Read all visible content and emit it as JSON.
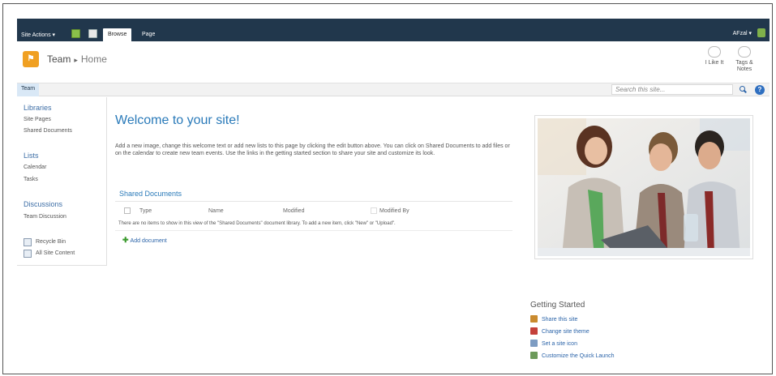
{
  "ribbon": {
    "site_actions": "Site Actions ▾",
    "tabs": [
      {
        "label": "Browse"
      },
      {
        "label": "Page"
      }
    ],
    "user": "AFzal ▾"
  },
  "header": {
    "site_name": "Team",
    "separator": "▸",
    "page_name": "Home",
    "i_like_it": "I Like It",
    "tags_notes_1": "Tags &",
    "tags_notes_2": "Notes"
  },
  "topnav": {
    "team": "Team",
    "search_placeholder": "Search this site..."
  },
  "leftnav": {
    "libraries": "Libraries",
    "site_pages": "Site Pages",
    "shared_documents": "Shared Documents",
    "lists": "Lists",
    "calendar": "Calendar",
    "tasks": "Tasks",
    "discussions": "Discussions",
    "team_discussion": "Team Discussion",
    "recycle_bin": "Recycle Bin",
    "all_site_content": "All Site Content"
  },
  "main": {
    "title": "Welcome to your site!",
    "intro": "Add a new image, change this welcome text or add new lists to this page by clicking the edit button above. You can click on Shared Documents to add files or on the calendar to create new team events. Use the links in the getting started section to share your site and customize its look.",
    "shared_title": "Shared Documents",
    "columns": [
      "Type",
      "Name",
      "Modified",
      "Modified By"
    ],
    "empty_message": "There are no items to show in this view of the \"Shared Documents\" document library. To add a new item, click \"New\" or \"Upload\".",
    "add_document": "Add document"
  },
  "getting_started": {
    "title": "Getting Started",
    "items": [
      {
        "label": "Share this site",
        "icon": "share-icon",
        "color": "#c98a2e"
      },
      {
        "label": "Change site theme",
        "icon": "theme-icon",
        "color": "#c4413a"
      },
      {
        "label": "Set a site icon",
        "icon": "site-icon-icon",
        "color": "#7d9cc2"
      },
      {
        "label": "Customize the Quick Launch",
        "icon": "quick-launch-icon",
        "color": "#6c9a5a"
      }
    ]
  },
  "colors": {
    "ribbon": "#21374c",
    "link": "#2a7ab9",
    "accent": "#f0a022"
  }
}
